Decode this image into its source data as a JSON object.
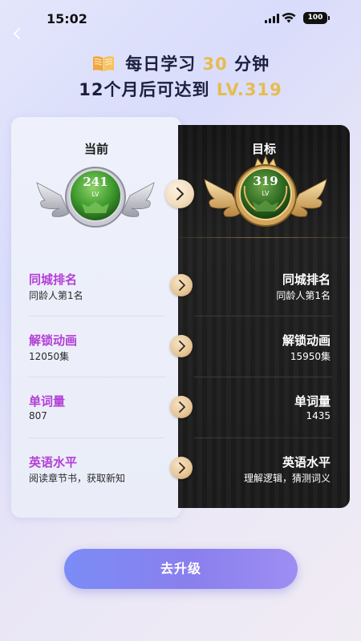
{
  "status_bar": {
    "time": "15:02",
    "battery": "100"
  },
  "header": {
    "line1_prefix": "每日学习",
    "line1_minutes": "30",
    "line1_suffix": "分钟",
    "line2_prefix": "12个月后可达到",
    "line2_level": "LV.319",
    "accent_color": "#e6bc4f"
  },
  "columns": {
    "current": {
      "title": "当前",
      "level": "241",
      "lv": "LV"
    },
    "target": {
      "title": "目标",
      "level": "319",
      "lv": "LV"
    }
  },
  "rows": [
    {
      "title": "同城排名",
      "current": "同龄人第1名",
      "target": "同龄人第1名"
    },
    {
      "title": "解锁动画",
      "current": "12050集",
      "target": "15950集"
    },
    {
      "title": "单词量",
      "current": "807",
      "target": "1435"
    },
    {
      "title": "英语水平",
      "current": "阅读章节书，获取新知",
      "target": "理解逻辑，猜测词义"
    }
  ],
  "actions": {
    "upgrade_label": "去升级"
  },
  "icons": {
    "back": "chevron-left-icon",
    "book": "book-icon",
    "arrow": "chevron-right-icon"
  }
}
